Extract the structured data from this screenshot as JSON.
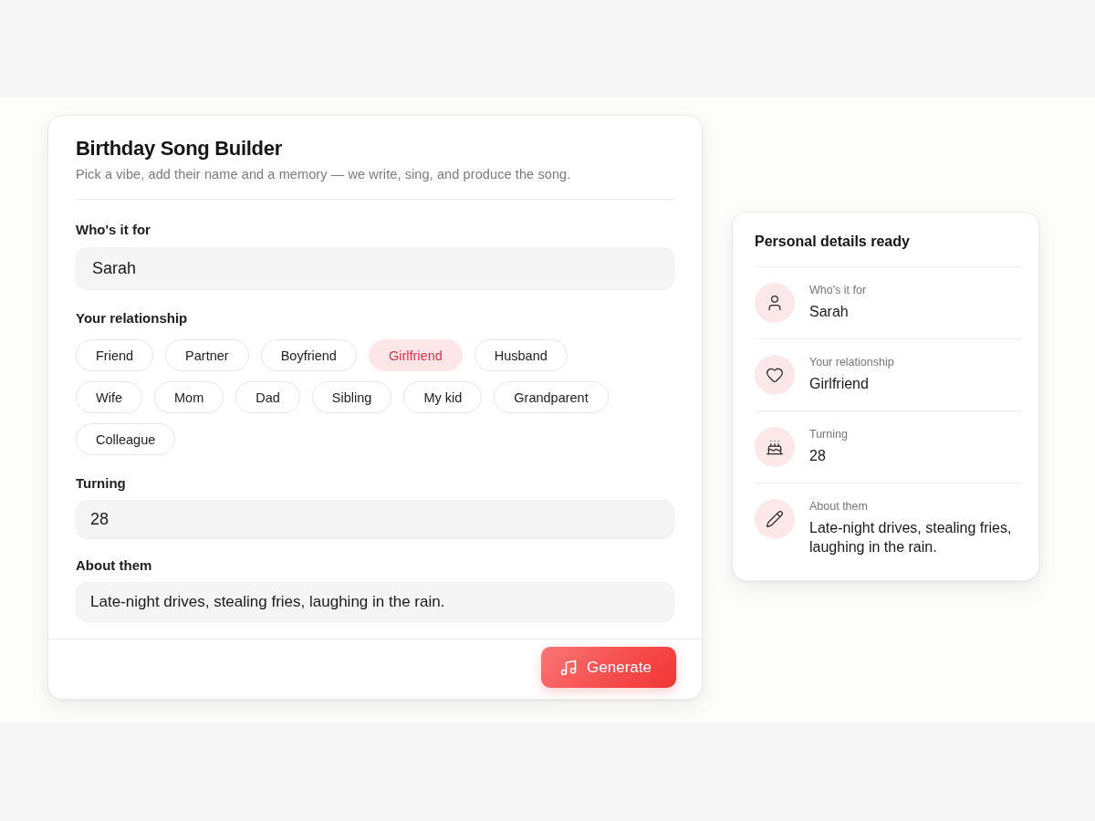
{
  "form": {
    "title": "Birthday Song Builder",
    "subtitle": "Pick a vibe, add their name and a memory — we write, sing, and produce the song.",
    "fields": [
      {
        "kind": "text",
        "label": "Who's it for",
        "value": "Sarah"
      },
      {
        "kind": "chips",
        "label": "Your relationship",
        "options": [
          {
            "label": "Friend",
            "selected": false
          },
          {
            "label": "Partner",
            "selected": false
          },
          {
            "label": "Boyfriend",
            "selected": false
          },
          {
            "label": "Girlfriend",
            "selected": true
          },
          {
            "label": "Husband",
            "selected": false
          },
          {
            "label": "Wife",
            "selected": false
          },
          {
            "label": "Mom",
            "selected": false
          },
          {
            "label": "Dad",
            "selected": false
          },
          {
            "label": "Sibling",
            "selected": false
          },
          {
            "label": "My kid",
            "selected": false
          },
          {
            "label": "Grandparent",
            "selected": false
          },
          {
            "label": "Colleague",
            "selected": false
          }
        ]
      },
      {
        "kind": "number",
        "label": "Turning",
        "value": "28"
      },
      {
        "kind": "memo",
        "label": "About them",
        "value": "Late-night drives, stealing fries, laughing in the rain."
      }
    ],
    "generate_button": {
      "label": "Generate"
    }
  },
  "summary": {
    "title": "Personal details ready",
    "items": [
      {
        "kind": "person",
        "label": "Who's it for",
        "value": "Sarah"
      },
      {
        "kind": "heart",
        "label": "Your relationship",
        "value": "Girlfriend"
      },
      {
        "kind": "cake",
        "label": "Turning",
        "value": "28"
      },
      {
        "kind": "pencil",
        "label": "About them",
        "value": "Late-night drives, stealing fries, laughing in the rain."
      }
    ]
  }
}
